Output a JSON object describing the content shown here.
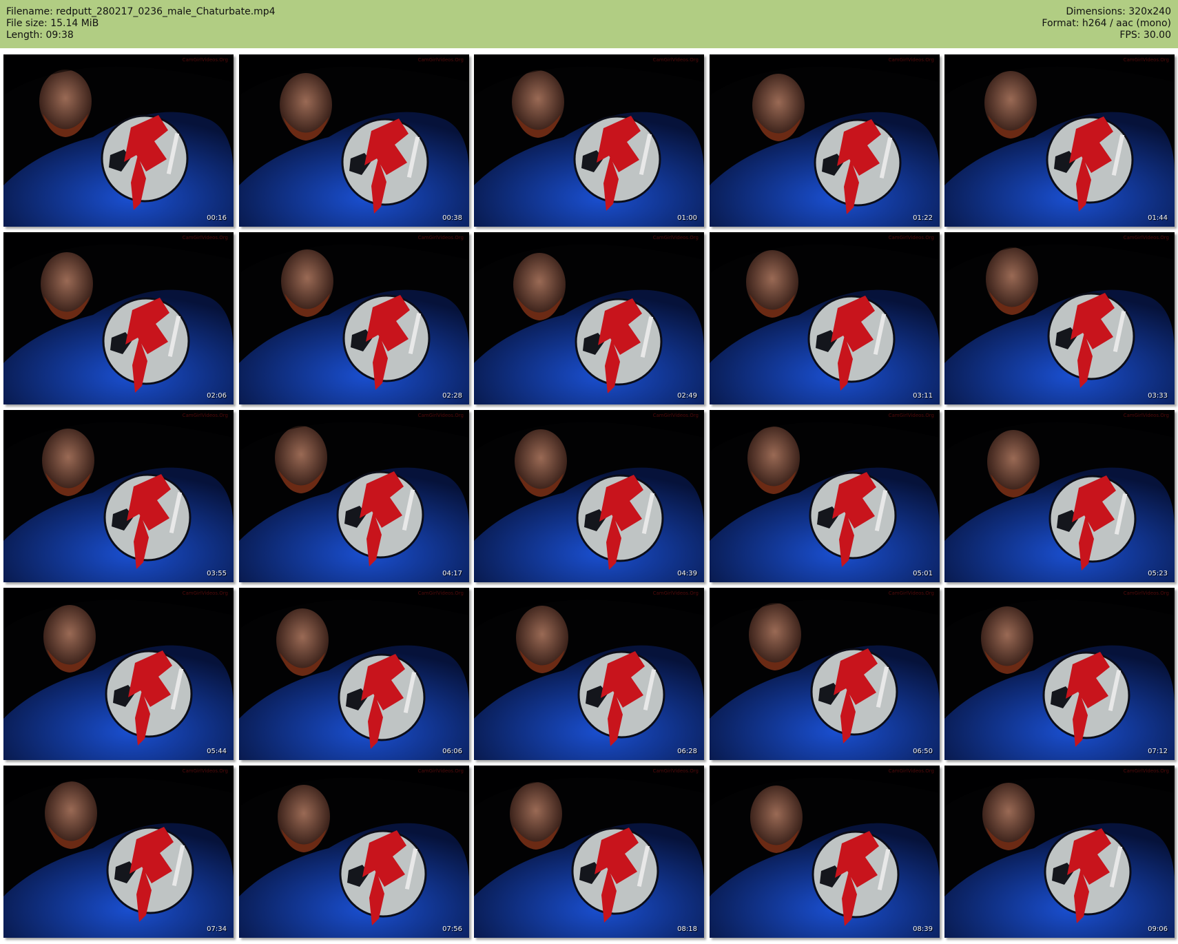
{
  "header": {
    "filename": "Filename: redputt_280217_0236_male_Chaturbate.mp4",
    "filesize": "File size: 15.14 MiB",
    "length": "Length: 09:38",
    "dimensions": "Dimensions: 320x240",
    "format": "Format: h264 / aac (mono)",
    "fps": "FPS: 30.00"
  },
  "thumbnails": [
    {
      "time": "00:16"
    },
    {
      "time": "00:38"
    },
    {
      "time": "01:00"
    },
    {
      "time": "01:22"
    },
    {
      "time": "01:44"
    },
    {
      "time": "02:06"
    },
    {
      "time": "02:28"
    },
    {
      "time": "02:49"
    },
    {
      "time": "03:11"
    },
    {
      "time": "03:33"
    },
    {
      "time": "03:55"
    },
    {
      "time": "04:17"
    },
    {
      "time": "04:39"
    },
    {
      "time": "05:01"
    },
    {
      "time": "05:23"
    },
    {
      "time": "05:44"
    },
    {
      "time": "06:06"
    },
    {
      "time": "06:28"
    },
    {
      "time": "06:50"
    },
    {
      "time": "07:12"
    },
    {
      "time": "07:34"
    },
    {
      "time": "07:56"
    },
    {
      "time": "08:18"
    },
    {
      "time": "08:39"
    },
    {
      "time": "09:06"
    }
  ],
  "watermark": "CamGirlVideos.Org",
  "colors": {
    "header_bg": "#b1cd83",
    "shirt": "#1a4fd0",
    "logo_red": "#c8141c",
    "moon": "#bfc4c4"
  }
}
